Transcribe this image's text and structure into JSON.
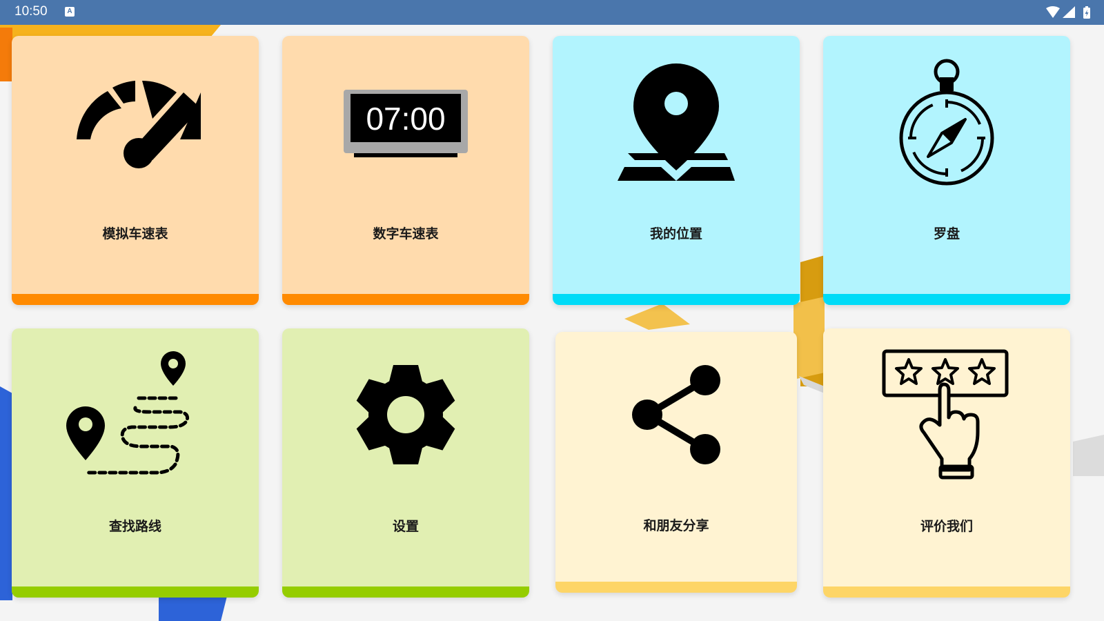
{
  "status_bar": {
    "time": "10:50",
    "notification_icon": "a-icon",
    "indicators": [
      "wifi-icon",
      "signal-icon",
      "battery-icon"
    ]
  },
  "colors": {
    "status_bar": "#4a76ac",
    "orange_card": "#ffdbad",
    "orange_accent": "#ff8a00",
    "cyan_card": "#b2f4fe",
    "cyan_accent": "#00dbf7",
    "green_card": "#e1efb2",
    "green_accent": "#95cd00",
    "yellow_card": "#fff3d2",
    "yellow_accent": "#fdd567"
  },
  "cards": [
    {
      "label": "模拟车速表",
      "icon": "speedometer-icon"
    },
    {
      "label": "数字车速表",
      "icon": "digital-clock-icon",
      "display": "07:00"
    },
    {
      "label": "我的位置",
      "icon": "location-map-icon"
    },
    {
      "label": "罗盘",
      "icon": "compass-icon"
    },
    {
      "label": "查找路线",
      "icon": "route-icon"
    },
    {
      "label": "设置",
      "icon": "gear-icon"
    },
    {
      "label": "和朋友分享",
      "icon": "share-icon"
    },
    {
      "label": "评价我们",
      "icon": "rate-stars-icon"
    }
  ]
}
